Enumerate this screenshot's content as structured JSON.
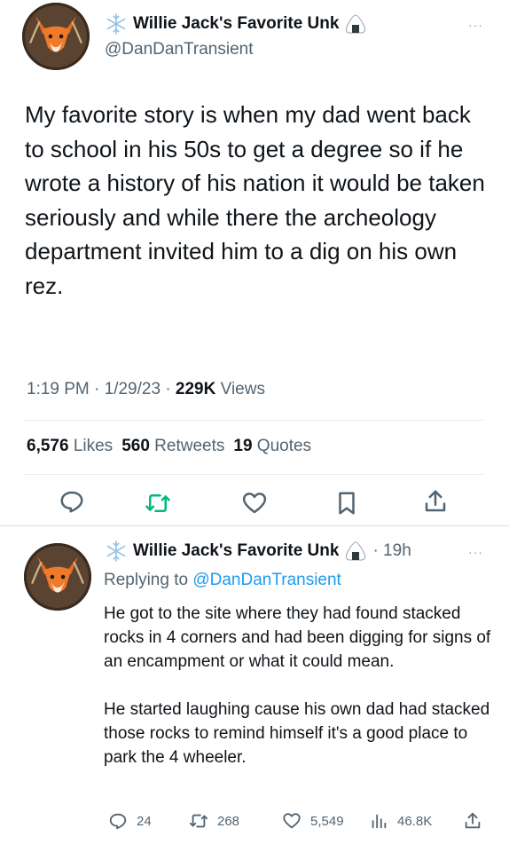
{
  "tweet": {
    "display_name": "Willie Jack's Favorite Unk",
    "handle": "@DanDanTransient",
    "text": "My favorite story is when my dad went back to school in his 50s to get a degree so if he wrote a history of his nation it would be taken seriously and while there the archeology department invited him to a dig on his own rez.",
    "time": "1:19 PM · 1/29/23 · ",
    "views_count": "229K",
    "views_label": " Views",
    "likes_count": "6,576",
    "likes_label": " Likes",
    "retweets_count": "560",
    "retweets_label": " Retweets",
    "quotes_count": "19",
    "quotes_label": " Quotes",
    "more": "···"
  },
  "reply": {
    "display_name": "Willie Jack's Favorite Unk",
    "time": "· 19h",
    "replying_prefix": "Replying to ",
    "replying_handle": "@DanDanTransient",
    "paragraph_1": "He got to the site where they had found stacked rocks in 4 corners and had been digging for signs of an encampment or what it could mean.",
    "paragraph_2": "He started laughing cause his own dad had stacked those rocks to remind himself it's a good place to park the 4 wheeler.",
    "replies": "24",
    "retweets": "268",
    "likes": "5,549",
    "views": "46.8K",
    "more": "···"
  },
  "icons": {
    "reply": "reply-icon",
    "retweet": "retweet-icon",
    "like": "heart-icon",
    "bookmark": "bookmark-icon",
    "share": "share-icon",
    "views": "views-icon",
    "snowflake": "snowflake-icon",
    "onigiri": "onigiri-icon",
    "avatar": "fox-avatar"
  },
  "colors": {
    "retweet_accent": "#00ba7c",
    "link": "#1d9bf0",
    "muted": "#536471",
    "text": "#0f1419"
  }
}
